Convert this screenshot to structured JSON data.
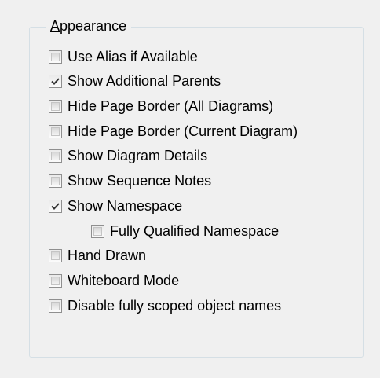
{
  "group": {
    "title_first": "A",
    "title_rest": "ppearance"
  },
  "options": [
    {
      "label": "Use Alias if Available",
      "checked": false
    },
    {
      "label": "Show Additional Parents",
      "checked": true
    },
    {
      "label": "Hide Page Border (All Diagrams)",
      "checked": false
    },
    {
      "label": "Hide Page Border (Current Diagram)",
      "checked": false
    },
    {
      "label": "Show Diagram Details",
      "checked": false
    },
    {
      "label": "Show Sequence Notes",
      "checked": false
    },
    {
      "label": "Show Namespace",
      "checked": true
    },
    {
      "label": "Fully Qualified Namespace",
      "checked": false
    },
    {
      "label": "Hand Drawn",
      "checked": false
    },
    {
      "label": "Whiteboard Mode",
      "checked": false
    },
    {
      "label": "Disable fully scoped object names",
      "checked": false
    }
  ]
}
